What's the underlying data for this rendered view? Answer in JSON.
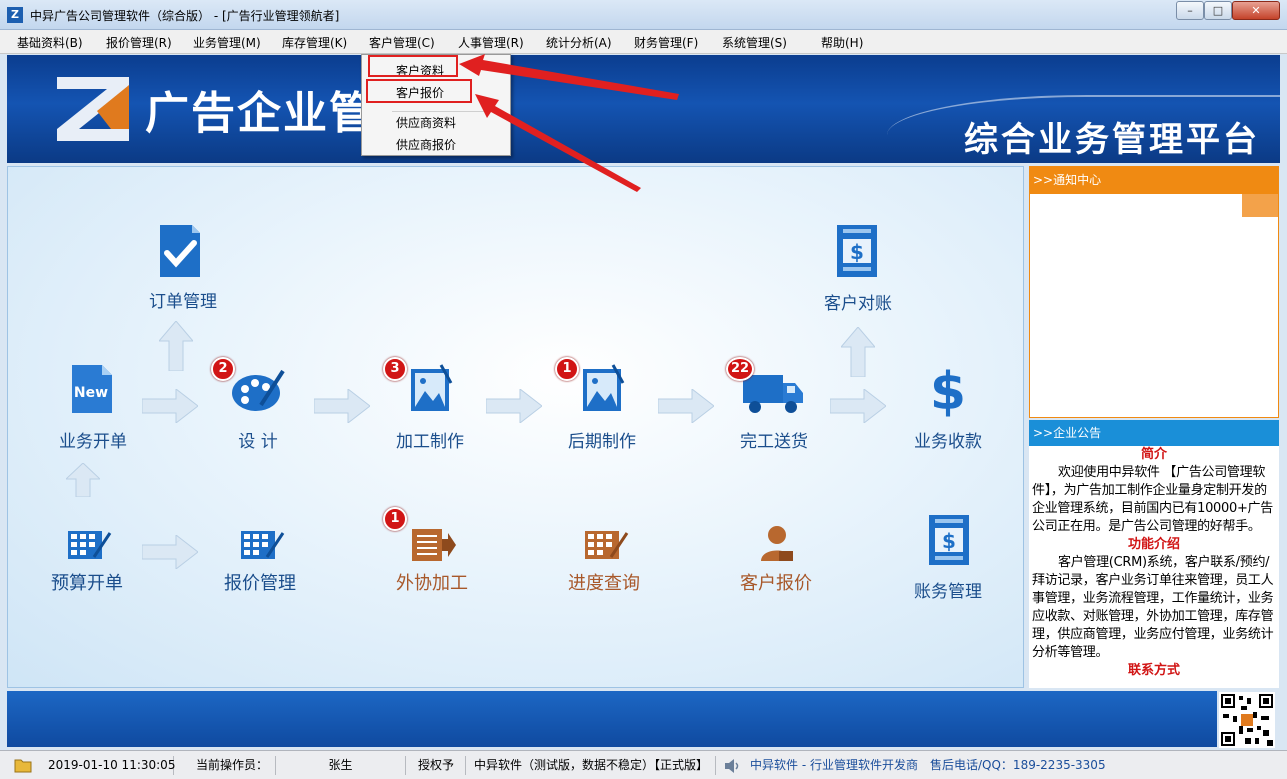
{
  "window": {
    "app_icon": "Z",
    "title": "中异广告公司管理软件（综合版） - [广告行业管理领航者]",
    "minimize_glyph": "–",
    "maximize_glyph": "□",
    "close_glyph": "✕"
  },
  "menu": [
    "基础资料(B)",
    "报价管理(R)",
    "业务管理(M)",
    "库存管理(K)",
    "客户管理(C)",
    "人事管理(R)",
    "统计分析(A)",
    "财务管理(F)",
    "系统管理(S)",
    "帮助(H)"
  ],
  "dropdown": {
    "items": [
      "客户资料",
      "客户报价",
      "供应商资料",
      "供应商报价"
    ],
    "highlighted": [
      "客户资料",
      "客户报价"
    ],
    "annotation_color": "#e02020"
  },
  "banner": {
    "logo_text": "广告企业管理系统",
    "slogan": "综合业务管理平台"
  },
  "flow": {
    "nodes": {
      "order": "订单管理",
      "customer_reconcile": "客户对账",
      "business_open": "业务开单",
      "design": "设  计",
      "processing": "加工制作",
      "post_production": "后期制作",
      "delivery": "完工送货",
      "payment": "业务收款",
      "budget": "预算开单",
      "quote": "报价管理",
      "outsource": "外协加工",
      "progress": "进度查询",
      "customer_quote": "客户报价",
      "accounts": "账务管理"
    },
    "badges": {
      "design": "2",
      "processing": "3",
      "post_production": "1",
      "delivery": "22",
      "outsource": "1"
    },
    "new_icon_text": "New"
  },
  "notice": {
    "header": ">>通知中心"
  },
  "bulletin": {
    "header": ">>企业公告",
    "intro_title": "简介",
    "intro_text": "欢迎使用中异软件 【广告公司管理软件】，为广告加工制作企业量身定制开发的企业管理系统，目前国内已有10000+广告公司正在用。是广告公司管理的好帮手。",
    "feature_title": "功能介绍",
    "feature_text": "客户管理(CRM)系统，客户联系/预约/拜访记录，客户业务订单往来管理，员工人事管理，业务流程管理，工作量统计，业务应收款、对账管理，外协加工管理，库存管理，供应商管理，业务应付管理，业务统计分析等管理。",
    "contact_title": "联系方式"
  },
  "status": {
    "datetime": "2019-01-10 11:30:05",
    "operator_label": "当前操作员：",
    "operator": "张生",
    "license_label": "授权予",
    "license": "中异软件（测试版，数据不稳定）【正式版】",
    "vendor": "中异软件 - 行业管理软件开发商",
    "support": "售后电话/QQ：189-2235-3305"
  },
  "colors": {
    "banner_blue": "#1454b2",
    "notice_orange": "#f08a12",
    "bulletin_blue": "#1a8fd8",
    "badge_red": "#d11515"
  }
}
